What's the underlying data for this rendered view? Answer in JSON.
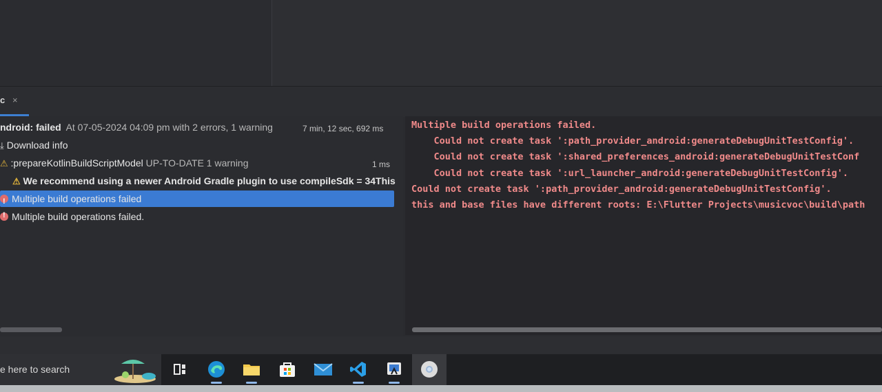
{
  "tool_window": {
    "tab_label": "c",
    "tab_close": "×"
  },
  "build_tree": {
    "rows": [
      {
        "title": "ndroid: failed",
        "detail": "At 07-05-2024 04:09 pm with 2 errors, 1 warning",
        "duration": "7 min, 12 sec, 692 ms"
      },
      {
        "title": "Download info"
      },
      {
        "title": ":prepareKotlinBuildScriptModel",
        "detail": "UP-TO-DATE 1 warning",
        "duration": "1 ms"
      },
      {
        "title": "We recommend using a newer Android Gradle plugin to use compileSdk = 34This"
      },
      {
        "title": "Multiple build operations failed"
      },
      {
        "title": "Multiple build operations failed."
      }
    ]
  },
  "console": {
    "lines": [
      "Multiple build operations failed.",
      "    Could not create task ':path_provider_android:generateDebugUnitTestConfig'.",
      "    Could not create task ':shared_preferences_android:generateDebugUnitTestConf",
      "    Could not create task ':url_launcher_android:generateDebugUnitTestConfig'.",
      "Could not create task ':path_provider_android:generateDebugUnitTestConfig'.",
      "this and base files have different roots: E:\\Flutter Projects\\musicvoc\\build\\path"
    ],
    "text_color": "#f08a8a"
  },
  "taskbar": {
    "search_text": "e here to search",
    "apps": [
      "task-view-icon",
      "edge-icon",
      "file-explorer-icon",
      "store-icon",
      "mail-icon",
      "vscode-icon",
      "android-studio-icon",
      "chrome-icon"
    ]
  },
  "colors": {
    "selection": "#3b7bd3",
    "warning": "#e2b43b",
    "error": "#e06c6c"
  }
}
